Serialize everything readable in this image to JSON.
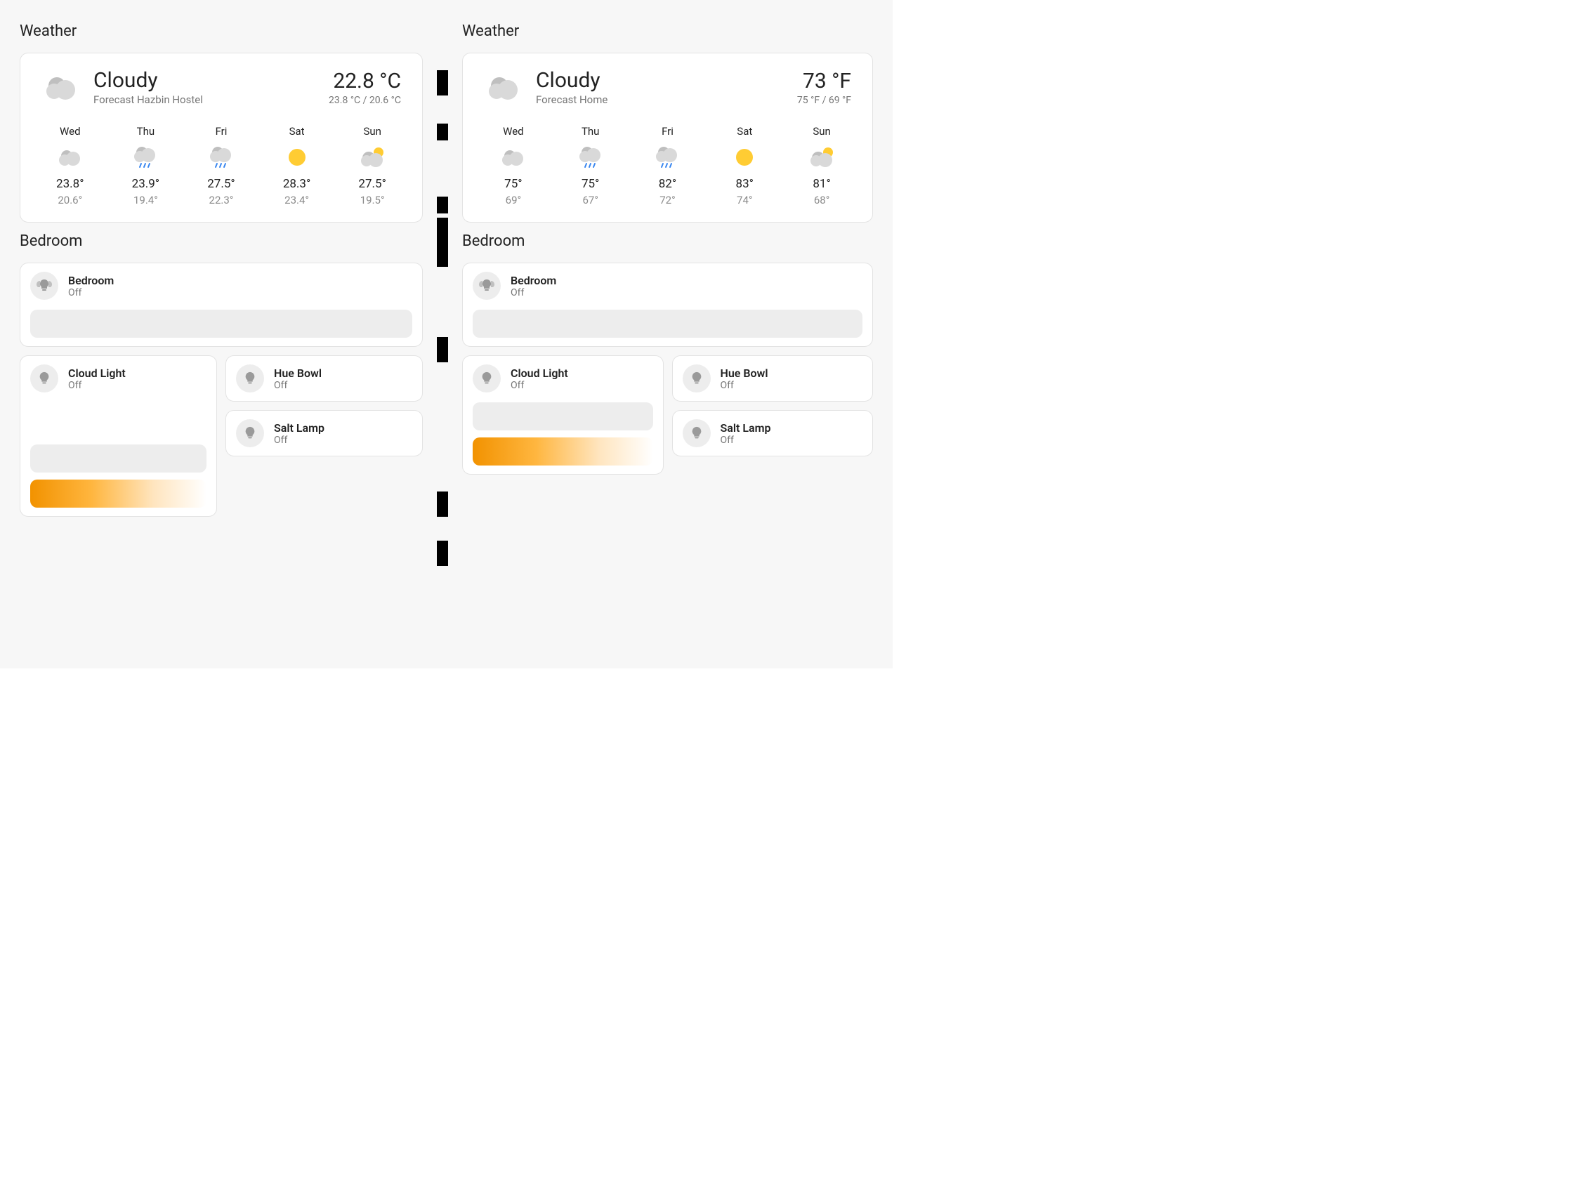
{
  "left": {
    "weather_title": "Weather",
    "condition": "Cloudy",
    "forecast_name": "Forecast Hazbin Hostel",
    "temp": "22.8 °C",
    "temp_sub": "23.8 °C / 20.6 °C",
    "days": [
      {
        "name": "Wed",
        "icon": "cloudy",
        "hi": "23.8°",
        "lo": "20.6°"
      },
      {
        "name": "Thu",
        "icon": "rainy",
        "hi": "23.9°",
        "lo": "19.4°"
      },
      {
        "name": "Fri",
        "icon": "rainy",
        "hi": "27.5°",
        "lo": "22.3°"
      },
      {
        "name": "Sat",
        "icon": "sunny",
        "hi": "28.3°",
        "lo": "23.4°"
      },
      {
        "name": "Sun",
        "icon": "partly",
        "hi": "27.5°",
        "lo": "19.5°"
      }
    ],
    "bedroom_title": "Bedroom",
    "group": {
      "name": "Bedroom",
      "state": "Off",
      "icon": "bulb-group"
    },
    "tiles": {
      "cloud": {
        "name": "Cloud Light",
        "state": "Off"
      },
      "hue": {
        "name": "Hue Bowl",
        "state": "Off"
      },
      "salt": {
        "name": "Salt Lamp",
        "state": "Off"
      }
    }
  },
  "right": {
    "weather_title": "Weather",
    "condition": "Cloudy",
    "forecast_name": "Forecast Home",
    "temp": "73 °F",
    "temp_sub": "75 °F / 69 °F",
    "days": [
      {
        "name": "Wed",
        "icon": "cloudy",
        "hi": "75°",
        "lo": "69°"
      },
      {
        "name": "Thu",
        "icon": "rainy",
        "hi": "75°",
        "lo": "67°"
      },
      {
        "name": "Fri",
        "icon": "rainy",
        "hi": "82°",
        "lo": "72°"
      },
      {
        "name": "Sat",
        "icon": "sunny",
        "hi": "83°",
        "lo": "74°"
      },
      {
        "name": "Sun",
        "icon": "partly",
        "hi": "81°",
        "lo": "68°"
      }
    ],
    "bedroom_title": "Bedroom",
    "group": {
      "name": "Bedroom",
      "state": "Off",
      "icon": "bulb-group"
    },
    "tiles": {
      "cloud": {
        "name": "Cloud Light",
        "state": "Off"
      },
      "hue": {
        "name": "Hue Bowl",
        "state": "Off"
      },
      "salt": {
        "name": "Salt Lamp",
        "state": "Off"
      }
    }
  }
}
